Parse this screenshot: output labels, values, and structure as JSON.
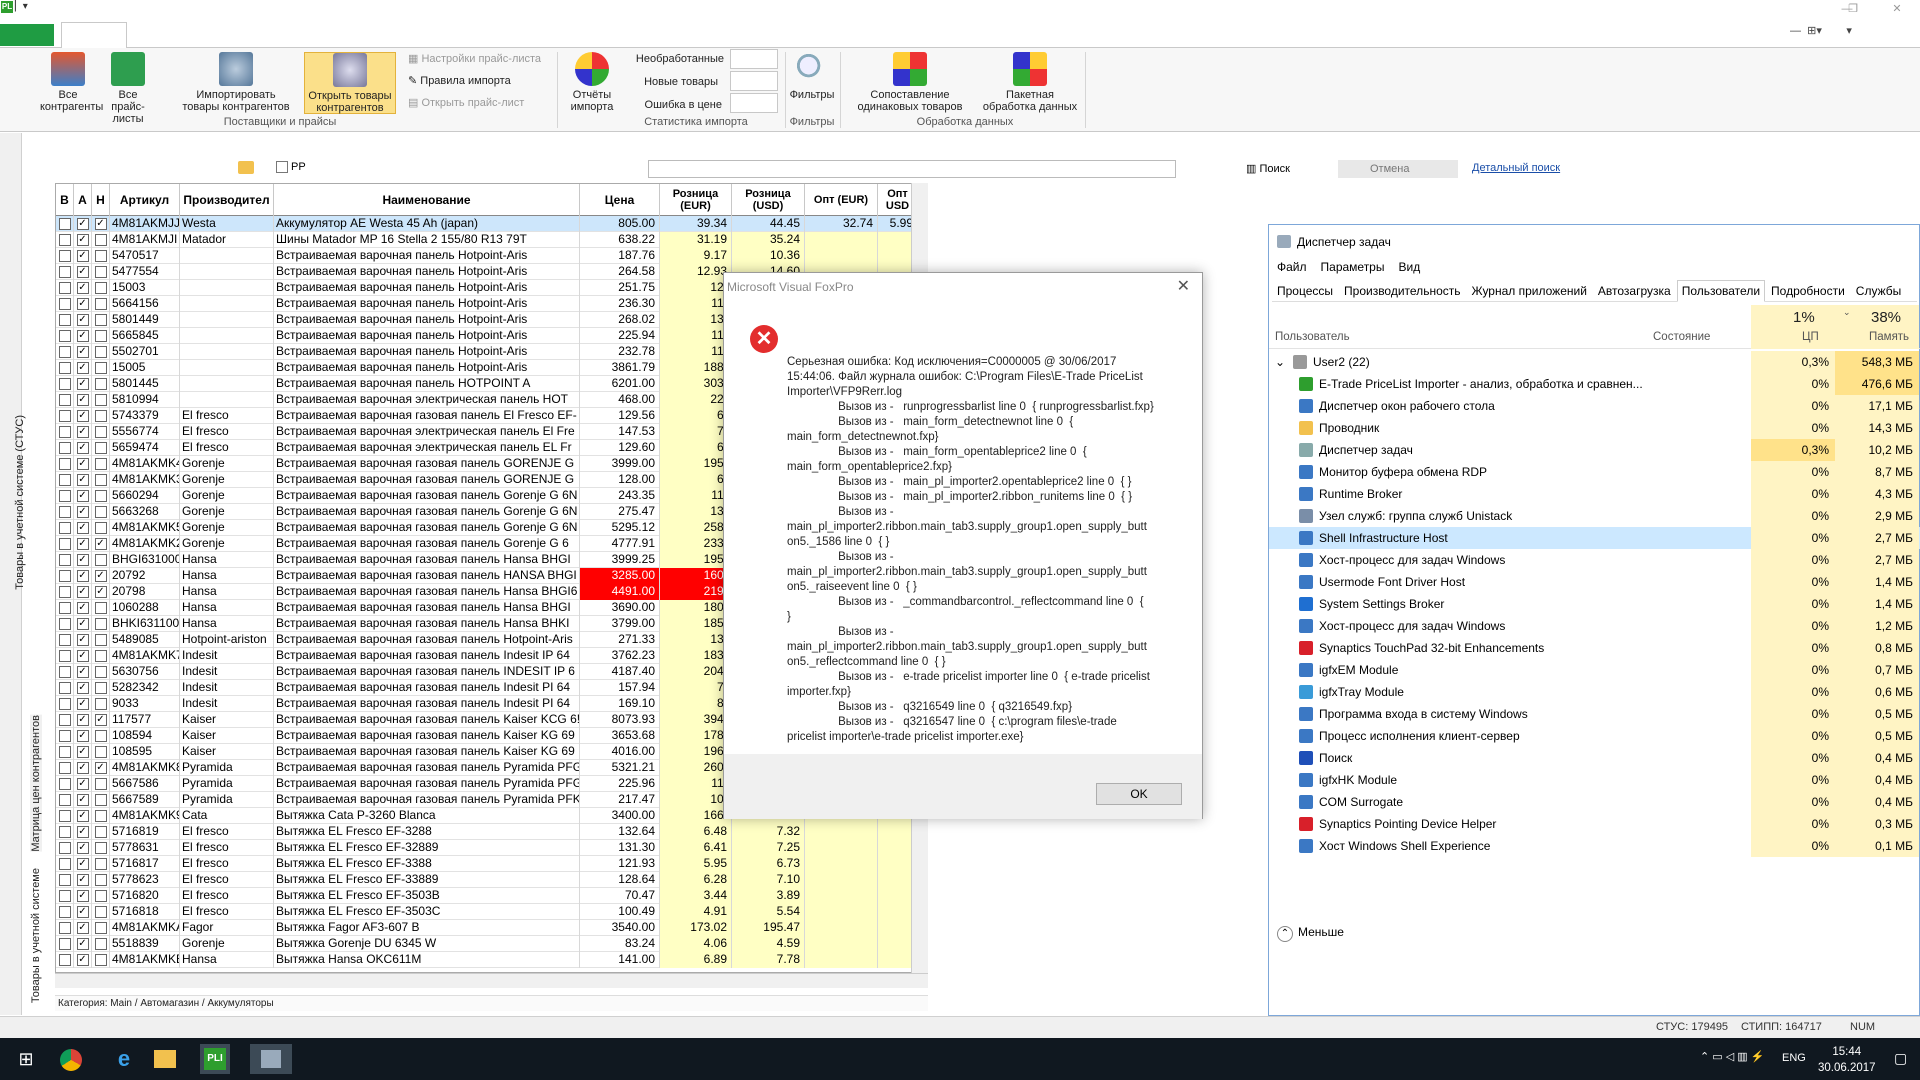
{
  "ribbon": {
    "all_contractors": "Все\nконтрагенты",
    "all_pricelists": "Все\nпрайс-листы",
    "import_goods": "Импортировать\nтовары контрагентов",
    "open_goods": "Открыть товары\nконтрагентов",
    "pricelist_settings": "Настройки прайс-листа",
    "import_rules": "Правила импорта",
    "open_pricelist": "Открыть прайс-лист",
    "group_suppliers": "Поставщики и прайсы",
    "unprocessed": "Необработанные",
    "new_goods": "Новые товары",
    "price_errors": "Ошибка в цене",
    "import_reports": "Отчёты\nимпорта",
    "group_stats": "Статистика импорта",
    "filters": "Фильтры",
    "group_filters": "Фильтры",
    "match_goods": "Сопоставление\nодинаковых товаров",
    "batch_processing": "Пакетная\nобработка данных",
    "group_processing": "Обработка данных"
  },
  "toolbar": {
    "pp_label": "PP",
    "search": "Поиск",
    "cancel": "Отмена",
    "advanced_search": "Детальный поиск"
  },
  "side_tabs": {
    "tab1": "Товары в учетной системе (СТУС)",
    "tab2": "Матрица цен контрагентов",
    "tab3": "Товары в учетной системе"
  },
  "grid": {
    "headers": [
      "В",
      "А",
      "Н",
      "Артикул",
      "Производител",
      "Наименование",
      "Цена",
      "Розница (EUR)",
      "Розница (USD)",
      "Опт (EUR)",
      "Опт USD"
    ],
    "rows": [
      {
        "b": false,
        "a": true,
        "n": true,
        "sku": "4M81AKMJJ",
        "mfr": "Westa",
        "name": "Аккумулятор AE Westa 45 Ah (japan)",
        "price": "805.00",
        "reur": "39.34",
        "rusd": "44.45",
        "oeur": "32.74",
        "ousd": "5.99",
        "sel": true
      },
      {
        "b": false,
        "a": true,
        "n": false,
        "sku": "4M81AKMJI",
        "mfr": "Matador",
        "name": "Шины Matador MP 16 Stella 2 155/80 R13 79T",
        "price": "638.22",
        "reur": "31.19",
        "rusd": "35.24"
      },
      {
        "b": false,
        "a": true,
        "n": false,
        "sku": "5470517",
        "mfr": "",
        "name": "Встраиваемая варочная панель Hotpoint-Aris",
        "price": "187.76",
        "reur": "9.17",
        "rusd": "10.36"
      },
      {
        "b": false,
        "a": true,
        "n": false,
        "sku": "5477554",
        "mfr": "",
        "name": "Встраиваемая варочная панель Hotpoint-Aris",
        "price": "264.58",
        "reur": "12.93",
        "rusd": "14.60"
      },
      {
        "b": false,
        "a": true,
        "n": false,
        "sku": "15003",
        "mfr": "",
        "name": "Встраиваемая варочная панель Hotpoint-Aris",
        "price": "251.75",
        "reur": "12.",
        "rusd": ""
      },
      {
        "b": false,
        "a": true,
        "n": false,
        "sku": "5664156",
        "mfr": "",
        "name": "Встраиваемая варочная панель Hotpoint-Aris",
        "price": "236.30",
        "reur": "11.",
        "rusd": ""
      },
      {
        "b": false,
        "a": true,
        "n": false,
        "sku": "5801449",
        "mfr": "",
        "name": "Встраиваемая варочная панель Hotpoint-Aris",
        "price": "268.02",
        "reur": "13.",
        "rusd": ""
      },
      {
        "b": false,
        "a": true,
        "n": false,
        "sku": "5665845",
        "mfr": "",
        "name": "Встраиваемая варочная панель Hotpoint-Aris",
        "price": "225.94",
        "reur": "11.",
        "rusd": ""
      },
      {
        "b": false,
        "a": true,
        "n": false,
        "sku": "5502701",
        "mfr": "",
        "name": "Встраиваемая варочная панель Hotpoint-Aris",
        "price": "232.78",
        "reur": "11.",
        "rusd": ""
      },
      {
        "b": false,
        "a": true,
        "n": false,
        "sku": "15005",
        "mfr": "",
        "name": "Встраиваемая варочная панель Hotpoint-Aris",
        "price": "3861.79",
        "reur": "188.",
        "rusd": ""
      },
      {
        "b": false,
        "a": true,
        "n": false,
        "sku": "5801445",
        "mfr": "",
        "name": "Встраиваемая варочная панель HOTPOINT A",
        "price": "6201.00",
        "reur": "303.",
        "rusd": ""
      },
      {
        "b": false,
        "a": true,
        "n": false,
        "sku": "5810994",
        "mfr": "",
        "name": "Встраиваемая варочная электрическая панель HOT",
        "price": "468.00",
        "reur": "22.",
        "rusd": ""
      },
      {
        "b": false,
        "a": true,
        "n": false,
        "sku": "5743379",
        "mfr": "El fresco",
        "name": "Встраиваемая варочная газовая панель El Fresco EF-",
        "price": "129.56",
        "reur": "6.",
        "rusd": ""
      },
      {
        "b": false,
        "a": true,
        "n": false,
        "sku": "5556774",
        "mfr": "El fresco",
        "name": "Встраиваемая варочная электрическая панель El Fre",
        "price": "147.53",
        "reur": "7.",
        "rusd": ""
      },
      {
        "b": false,
        "a": true,
        "n": false,
        "sku": "5659474",
        "mfr": "El fresco",
        "name": "Встраиваемая варочная электрическая панель EL Fr",
        "price": "129.60",
        "reur": "6.",
        "rusd": ""
      },
      {
        "b": false,
        "a": true,
        "n": false,
        "sku": "4M81AKMK4",
        "mfr": "Gorenje",
        "name": "Встраиваемая варочная газовая панель GORENJE G",
        "price": "3999.00",
        "reur": "195.",
        "rusd": ""
      },
      {
        "b": false,
        "a": true,
        "n": false,
        "sku": "4M81AKMK3",
        "mfr": "Gorenje",
        "name": "Встраиваемая варочная газовая панель GORENJE G",
        "price": "128.00",
        "reur": "6.",
        "rusd": ""
      },
      {
        "b": false,
        "a": true,
        "n": false,
        "sku": "5660294",
        "mfr": "Gorenje",
        "name": "Встраиваемая варочная газовая панель Gorenje G 6N",
        "price": "243.35",
        "reur": "11.",
        "rusd": ""
      },
      {
        "b": false,
        "a": true,
        "n": false,
        "sku": "5663268",
        "mfr": "Gorenje",
        "name": "Встраиваемая варочная газовая панель Gorenje G 6N",
        "price": "275.47",
        "reur": "13.",
        "rusd": ""
      },
      {
        "b": false,
        "a": true,
        "n": false,
        "sku": "4M81AKMK5",
        "mfr": "Gorenje",
        "name": "Встраиваемая варочная газовая панель Gorenje G 6N",
        "price": "5295.12",
        "reur": "258.",
        "rusd": ""
      },
      {
        "b": false,
        "a": true,
        "n": true,
        "sku": "4M81AKMK2",
        "mfr": "Gorenje",
        "name": "Встраиваемая варочная газовая панель Gorenje G 6",
        "price": "4777.91",
        "reur": "233.",
        "rusd": ""
      },
      {
        "b": false,
        "a": true,
        "n": false,
        "sku": "BHGI631000",
        "mfr": "Hansa",
        "name": "Встраиваемая варочная газовая панель Hansa BHGI",
        "price": "3999.25",
        "reur": "195.",
        "rusd": ""
      },
      {
        "b": false,
        "a": true,
        "n": true,
        "sku": "20792",
        "mfr": "Hansa",
        "name": "Встраиваемая варочная газовая панель HANSA BHGI",
        "price": "3285.00",
        "reur": "160.",
        "rusd": "",
        "red": true
      },
      {
        "b": false,
        "a": true,
        "n": true,
        "sku": "20798",
        "mfr": "Hansa",
        "name": "Встраиваемая варочная газовая панель Hansa BHGI6",
        "price": "4491.00",
        "reur": "219.",
        "rusd": "",
        "red": true
      },
      {
        "b": false,
        "a": true,
        "n": false,
        "sku": "1060288",
        "mfr": "Hansa",
        "name": "Встраиваемая варочная газовая панель Hansa BHGI",
        "price": "3690.00",
        "reur": "180.",
        "rusd": ""
      },
      {
        "b": false,
        "a": true,
        "n": false,
        "sku": "BHKI631100",
        "mfr": "Hansa",
        "name": "Встраиваемая варочная газовая панель Hansa BHKI",
        "price": "3799.00",
        "reur": "185.",
        "rusd": ""
      },
      {
        "b": false,
        "a": true,
        "n": false,
        "sku": "5489085",
        "mfr": "Hotpoint-ariston",
        "name": "Встраиваемая варочная газовая панель Hotpoint-Aris",
        "price": "271.33",
        "reur": "13.",
        "rusd": ""
      },
      {
        "b": false,
        "a": true,
        "n": false,
        "sku": "4M81AKMK7",
        "mfr": "Indesit",
        "name": "Встраиваемая варочная газовая панель Indesit IP 64",
        "price": "3762.23",
        "reur": "183.",
        "rusd": ""
      },
      {
        "b": false,
        "a": true,
        "n": false,
        "sku": "5630756",
        "mfr": "Indesit",
        "name": "Встраиваемая варочная газовая панель INDESIT IP 6",
        "price": "4187.40",
        "reur": "204.",
        "rusd": ""
      },
      {
        "b": false,
        "a": true,
        "n": false,
        "sku": "5282342",
        "mfr": "Indesit",
        "name": "Встраиваемая варочная газовая панель Indesit PI 64",
        "price": "157.94",
        "reur": "7.",
        "rusd": ""
      },
      {
        "b": false,
        "a": true,
        "n": false,
        "sku": "9033",
        "mfr": "Indesit",
        "name": "Встраиваемая варочная газовая панель Indesit PI 64",
        "price": "169.10",
        "reur": "8.",
        "rusd": ""
      },
      {
        "b": false,
        "a": true,
        "n": true,
        "sku": "117577",
        "mfr": "Kaiser",
        "name": "Встраиваемая варочная газовая панель Kaiser KCG 6!",
        "price": "8073.93",
        "reur": "394.",
        "rusd": ""
      },
      {
        "b": false,
        "a": true,
        "n": false,
        "sku": "108594",
        "mfr": "Kaiser",
        "name": "Встраиваемая варочная газовая панель Kaiser KG 69",
        "price": "3653.68",
        "reur": "178.",
        "rusd": ""
      },
      {
        "b": false,
        "a": true,
        "n": false,
        "sku": "108595",
        "mfr": "Kaiser",
        "name": "Встраиваемая варочная газовая панель Kaiser KG 69",
        "price": "4016.00",
        "reur": "196.",
        "rusd": ""
      },
      {
        "b": false,
        "a": true,
        "n": true,
        "sku": "4M81AKMK8",
        "mfr": "Pyramida",
        "name": "Встраиваемая варочная газовая панель Pyramida PFG",
        "price": "5321.21",
        "reur": "260.",
        "rusd": ""
      },
      {
        "b": false,
        "a": true,
        "n": false,
        "sku": "5667586",
        "mfr": "Pyramida",
        "name": "Встраиваемая варочная газовая панель Pyramida PFG",
        "price": "225.96",
        "reur": "11.",
        "rusd": ""
      },
      {
        "b": false,
        "a": true,
        "n": false,
        "sku": "5667589",
        "mfr": "Pyramida",
        "name": "Встраиваемая варочная газовая панель Pyramida PFK",
        "price": "217.47",
        "reur": "10.",
        "rusd": ""
      },
      {
        "b": false,
        "a": true,
        "n": false,
        "sku": "4M81AKMK9",
        "mfr": "Cata",
        "name": "Вытяжка Cata P-3260 Blanca",
        "price": "3400.00",
        "reur": "166.",
        "rusd": ""
      },
      {
        "b": false,
        "a": true,
        "n": false,
        "sku": "5716819",
        "mfr": "El fresco",
        "name": "Вытяжка EL Fresco EF-3288",
        "price": "132.64",
        "reur": "6.48",
        "rusd": "7.32"
      },
      {
        "b": false,
        "a": true,
        "n": false,
        "sku": "5778631",
        "mfr": "El fresco",
        "name": "Вытяжка EL Fresco EF-32889",
        "price": "131.30",
        "reur": "6.41",
        "rusd": "7.25"
      },
      {
        "b": false,
        "a": true,
        "n": false,
        "sku": "5716817",
        "mfr": "El fresco",
        "name": "Вытяжка EL Fresco EF-3388",
        "price": "121.93",
        "reur": "5.95",
        "rusd": "6.73"
      },
      {
        "b": false,
        "a": true,
        "n": false,
        "sku": "5778623",
        "mfr": "El fresco",
        "name": "Вытяжка EL Fresco EF-33889",
        "price": "128.64",
        "reur": "6.28",
        "rusd": "7.10"
      },
      {
        "b": false,
        "a": true,
        "n": false,
        "sku": "5716820",
        "mfr": "El fresco",
        "name": "Вытяжка EL Fresco EF-3503B",
        "price": "70.47",
        "reur": "3.44",
        "rusd": "3.89"
      },
      {
        "b": false,
        "a": true,
        "n": false,
        "sku": "5716818",
        "mfr": "El fresco",
        "name": "Вытяжка EL Fresco EF-3503C",
        "price": "100.49",
        "reur": "4.91",
        "rusd": "5.54"
      },
      {
        "b": false,
        "a": true,
        "n": false,
        "sku": "4M81AKMKA",
        "mfr": "Fagor",
        "name": "Вытяжка Fagor AF3-607 B",
        "price": "3540.00",
        "reur": "173.02",
        "rusd": "195.47"
      },
      {
        "b": false,
        "a": true,
        "n": false,
        "sku": "5518839",
        "mfr": "Gorenje",
        "name": "Вытяжка Gorenje DU 6345 W",
        "price": "83.24",
        "reur": "4.06",
        "rusd": "4.59"
      },
      {
        "b": false,
        "a": true,
        "n": false,
        "sku": "4M81AKMKB",
        "mfr": "Hansa",
        "name": "Вытяжка Hansa OKC611M",
        "price": "141.00",
        "reur": "6.89",
        "rusd": "7.78"
      }
    ]
  },
  "category": "Категория: Main / Автомагазин / Аккумуляторы",
  "statusbar": {
    "stus": "СТУС: 179495",
    "stipp": "СТИПП: 164717",
    "num": "NUM"
  },
  "dialog": {
    "title": "Microsoft Visual FoxPro",
    "message": "Серьезная ошибка: Код исключения=C0000005 @ 30/06/2017\n15:44:06. Файл журнала ошибок: C:\\Program Files\\E-Trade PriceList\nImporter\\VFP9Rerr.log\n                Вызов из -   runprogressbarlist line 0  { runprogressbarlist.fxp}\n                Вызов из -   main_form_detectnewnot line 0  {\nmain_form_detectnewnot.fxp}\n                Вызов из -   main_form_opentableprice2 line 0  {\nmain_form_opentableprice2.fxp}\n                Вызов из -   main_pl_importer2.opentableprice2 line 0  { }\n                Вызов из -   main_pl_importer2.ribbon_runitems line 0  { }\n                Вызов из -\nmain_pl_importer2.ribbon.main_tab3.supply_group1.open_supply_butt\non5._1586 line 0  { }\n                Вызов из -\nmain_pl_importer2.ribbon.main_tab3.supply_group1.open_supply_butt\non5._raiseevent line 0  { }\n                Вызов из -   _commandbarcontrol._reflectcommand line 0  {\n}\n                Вызов из -\nmain_pl_importer2.ribbon.main_tab3.supply_group1.open_supply_butt\non5._reflectcommand line 0  { }\n                Вызов из -   e-trade pricelist importer line 0  { e-trade pricelist\nimporter.fxp}\n                Вызов из -   q3216549 line 0  { q3216549.fxp}\n                Вызов из -   q3216547 line 0  { c:\\program files\\e-trade\npricelist importer\\e-trade pricelist importer.exe}",
    "ok": "OK"
  },
  "taskmgr": {
    "title": "Диспетчер задач",
    "menu": [
      "Файл",
      "Параметры",
      "Вид"
    ],
    "tabs": [
      "Процессы",
      "Производительность",
      "Журнал приложений",
      "Автозагрузка",
      "Пользователи",
      "Подробности",
      "Службы"
    ],
    "col_user": "Пользователь",
    "col_state": "Состояние",
    "cpu_total": "1%",
    "cpu_label": "ЦП",
    "mem_total": "38%",
    "mem_label": "Память",
    "user_row": {
      "name": "User2 (22)",
      "cpu": "0,3%",
      "mem": "548,3 МБ"
    },
    "processes": [
      {
        "name": "E-Trade PriceList Importer - анализ, обработка и сравнен...",
        "cpu": "0%",
        "mem": "476,6 МБ",
        "color": "#2e9e2e",
        "hot": true
      },
      {
        "name": "Диспетчер окон рабочего стола",
        "cpu": "0%",
        "mem": "17,1 МБ",
        "color": "#3b78c4"
      },
      {
        "name": "Проводник",
        "cpu": "0%",
        "mem": "14,3 МБ",
        "color": "#f2c14e"
      },
      {
        "name": "Диспетчер задач",
        "cpu": "0,3%",
        "mem": "10,2 МБ",
        "color": "#8aa",
        "hotcpu": true
      },
      {
        "name": "Монитор буфера обмена RDP",
        "cpu": "0%",
        "mem": "8,7 МБ",
        "color": "#3b78c4"
      },
      {
        "name": "Runtime Broker",
        "cpu": "0%",
        "mem": "4,3 МБ",
        "color": "#3b78c4"
      },
      {
        "name": "Узел служб: группа служб Unistack",
        "cpu": "0%",
        "mem": "2,9 МБ",
        "color": "#7a8ea8"
      },
      {
        "name": "Shell Infrastructure Host",
        "cpu": "0%",
        "mem": "2,7 МБ",
        "color": "#3b78c4",
        "sel": true
      },
      {
        "name": "Хост-процесс для задач Windows",
        "cpu": "0%",
        "mem": "2,7 МБ",
        "color": "#3b78c4"
      },
      {
        "name": "Usermode Font Driver Host",
        "cpu": "0%",
        "mem": "1,4 МБ",
        "color": "#3b78c4"
      },
      {
        "name": "System Settings Broker",
        "cpu": "0%",
        "mem": "1,4 МБ",
        "color": "#1f6fd1"
      },
      {
        "name": "Хост-процесс для задач Windows",
        "cpu": "0%",
        "mem": "1,2 МБ",
        "color": "#3b78c4"
      },
      {
        "name": "Synaptics TouchPad 32-bit Enhancements",
        "cpu": "0%",
        "mem": "0,8 МБ",
        "color": "#d8202a"
      },
      {
        "name": "igfxEM Module",
        "cpu": "0%",
        "mem": "0,7 МБ",
        "color": "#3b78c4"
      },
      {
        "name": "igfxTray Module",
        "cpu": "0%",
        "mem": "0,6 МБ",
        "color": "#3a9bd8"
      },
      {
        "name": "Программа входа в систему Windows",
        "cpu": "0%",
        "mem": "0,5 МБ",
        "color": "#3b78c4"
      },
      {
        "name": "Процесс исполнения клиент-сервер",
        "cpu": "0%",
        "mem": "0,5 МБ",
        "color": "#3b78c4"
      },
      {
        "name": "Поиск",
        "cpu": "0%",
        "mem": "0,4 МБ",
        "color": "#1f4fb8"
      },
      {
        "name": "igfxHK Module",
        "cpu": "0%",
        "mem": "0,4 МБ",
        "color": "#3b78c4"
      },
      {
        "name": "COM Surrogate",
        "cpu": "0%",
        "mem": "0,4 МБ",
        "color": "#3b78c4"
      },
      {
        "name": "Synaptics Pointing Device Helper",
        "cpu": "0%",
        "mem": "0,3 МБ",
        "color": "#d8202a"
      },
      {
        "name": "Хост Windows Shell Experience",
        "cpu": "0%",
        "mem": "0,1 МБ",
        "color": "#3b78c4"
      }
    ],
    "less": "Меньше"
  },
  "taskbar": {
    "lang": "ENG",
    "time": "15:44",
    "date": "30.06.2017"
  }
}
